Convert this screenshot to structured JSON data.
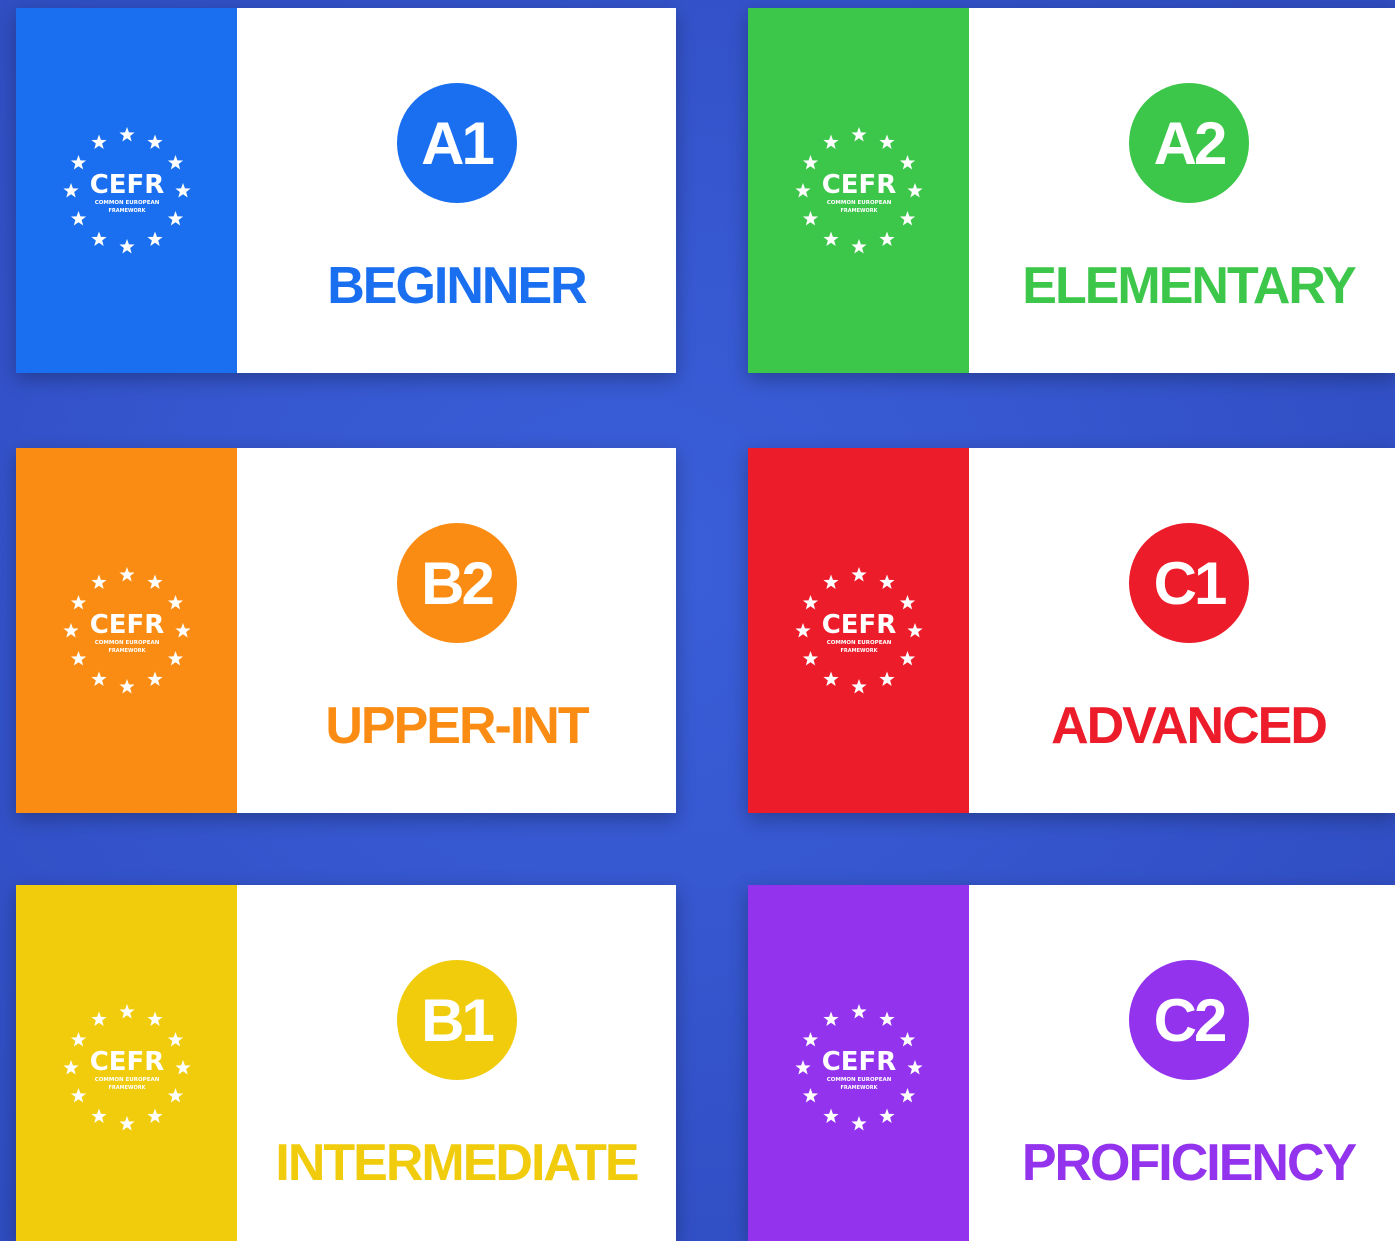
{
  "logo_text": "CEFR",
  "logo_subtext_1": "COMMON EUROPEAN",
  "logo_subtext_2": "FRAMEWORK",
  "levels": [
    {
      "code": "A1",
      "name": "BEGINNER",
      "color": "#1a6ff0"
    },
    {
      "code": "A2",
      "name": "ELEMENTARY",
      "color": "#3cc64a"
    },
    {
      "code": "B2",
      "name": "UPPER-INT",
      "color": "#fb8c13"
    },
    {
      "code": "C1",
      "name": "ADVANCED",
      "color": "#ec1c2a"
    },
    {
      "code": "B1",
      "name": "INTERMEDIATE",
      "color": "#f0cc0d"
    },
    {
      "code": "C2",
      "name": "PROFICIENCY",
      "color": "#9333ee"
    }
  ]
}
